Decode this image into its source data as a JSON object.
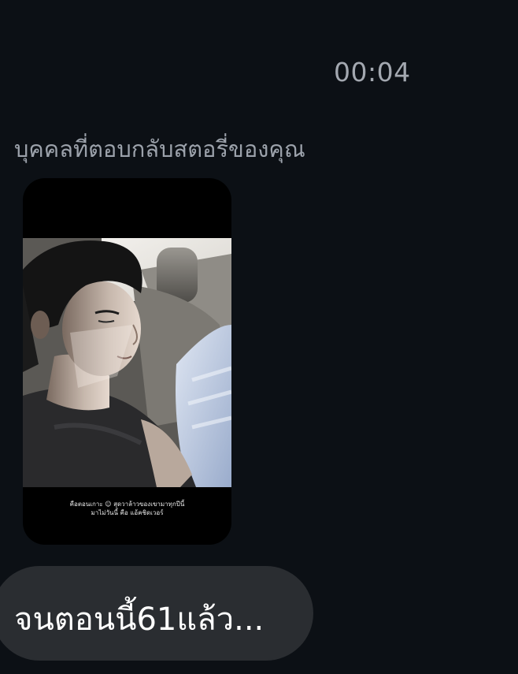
{
  "chat": {
    "timestamp": "00:04",
    "story_reply_label": "บุคคลที่ตอบกลับสตอรี่ของคุณ",
    "story": {
      "caption_line1": "คือตอนเกาะ ☺ สุดวาล้าวของเขามาทุกปีนี้",
      "caption_line2": "มาไม่วันนี้ คือ แอ้คชิดเวอร์"
    },
    "message": "จนตอนนี้61แล้ว..."
  },
  "colors": {
    "background": "#0c1015",
    "bubble": "#2a2d31",
    "timestamp_text": "#a3a8b0",
    "label_text": "#9ca2ab",
    "message_text": "#ffffff"
  }
}
